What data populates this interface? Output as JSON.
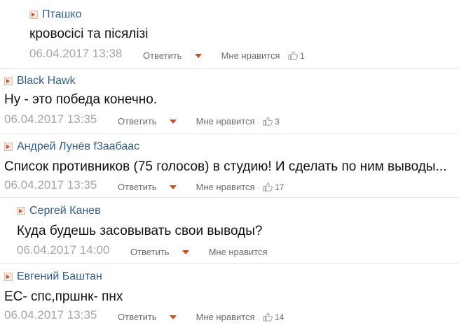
{
  "comments": [
    {
      "author": "Пташко",
      "text": "кровосісі та пісялізі",
      "date": "06.04.2017 13:38",
      "reply": "Ответить",
      "like": "Мне нравится",
      "likes": "1"
    },
    {
      "author": "Black Hawk",
      "text": "Ну - это победа конечно.",
      "date": "06.04.2017 13:35",
      "reply": "Ответить",
      "like": "Мне нравится",
      "likes": "3"
    },
    {
      "author": "Андрей Лунёв f3aабаас",
      "text": "Список противников (75 голосов) в студию! И сделать по ним выводы...",
      "date": "06.04.2017 13:35",
      "reply": "Ответить",
      "like": "Мне нравится",
      "likes": "17"
    },
    {
      "author": "Сергей Канев",
      "text": "Куда будешь засовывать свои выводы?",
      "date": "06.04.2017 14:00",
      "reply": "Ответить",
      "like": "Мне нравится",
      "likes": ""
    },
    {
      "author": "Евгений Баштан",
      "text": "ЕС- спс,пршнк- пнх",
      "date": "06.04.2017 13:35",
      "reply": "Ответить",
      "like": "Мне нравится",
      "likes": "14"
    }
  ]
}
